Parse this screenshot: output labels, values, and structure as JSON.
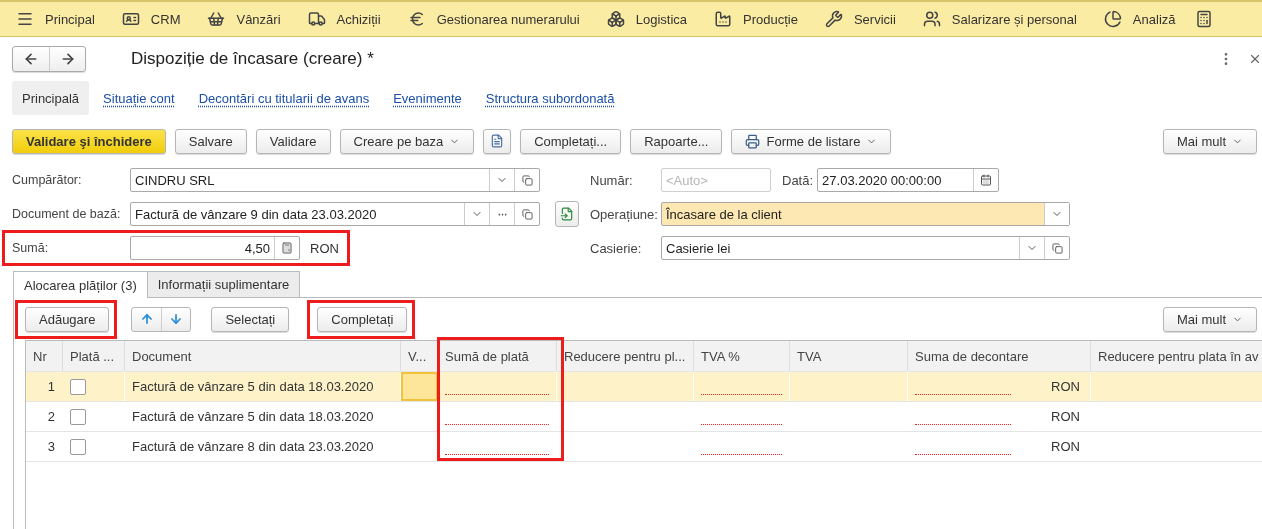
{
  "menu_bar": {
    "items": [
      {
        "label": "Principal"
      },
      {
        "label": "CRM"
      },
      {
        "label": "Vânzări"
      },
      {
        "label": "Achiziții"
      },
      {
        "label": "Gestionarea numerarului"
      },
      {
        "label": "Logistica"
      },
      {
        "label": "Producție"
      },
      {
        "label": "Servicii"
      },
      {
        "label": "Salarizare și personal"
      },
      {
        "label": "Analiză"
      }
    ]
  },
  "window": {
    "title": "Dispoziție de încasare (creare) *"
  },
  "section_tabs": [
    {
      "label": "Principală",
      "selected": true
    },
    {
      "label": "Situație cont",
      "selected": false
    },
    {
      "label": "Decontări cu titularii de avans",
      "selected": false
    },
    {
      "label": "Evenimente",
      "selected": false
    },
    {
      "label": "Structura subordonată",
      "selected": false
    }
  ],
  "toolbar": [
    {
      "kind": "primary",
      "label": "Validare şi închidere"
    },
    {
      "kind": "plain",
      "label": "Salvare"
    },
    {
      "kind": "plain",
      "label": "Validare"
    },
    {
      "kind": "menu",
      "label": "Creare pe baza"
    },
    {
      "kind": "icon"
    },
    {
      "kind": "plain",
      "label": "Completați..."
    },
    {
      "kind": "plain",
      "label": "Rapoarte..."
    },
    {
      "kind": "print",
      "label": "Forme de listare"
    }
  ],
  "toolbar_more": "Mai mult",
  "left_fields": [
    {
      "kind": "reference",
      "label": "Cumpărător:",
      "value": "CINDRU SRL"
    },
    {
      "kind": "document",
      "label": "Document de bază:",
      "value": "Factură de vânzare 9 din data 23.03.2020"
    },
    {
      "kind": "amount",
      "label": "Sumă:",
      "value": "4,50",
      "unit": "RON",
      "highlighted": true
    }
  ],
  "right_fields": [
    {
      "kind": "number",
      "label": "Număr:",
      "placeholder": "<Auto>",
      "date_label": "Dată:",
      "date_value": "27.03.2020 00:00:00",
      "active": false
    },
    {
      "kind": "choice",
      "label": "Operațiune:",
      "value": "Încasare de la client",
      "active": true
    },
    {
      "kind": "reference",
      "label": "Casierie:",
      "value": "Casierie lei",
      "active": false
    }
  ],
  "inner_tabs": [
    {
      "label": "Alocarea plăților (3)",
      "selected": true
    },
    {
      "label": "Informații suplimentare",
      "selected": false
    }
  ],
  "table_toolbar": [
    {
      "kind": "plain",
      "label": "Adăugare",
      "highlighted": true
    },
    {
      "kind": "arrows"
    },
    {
      "kind": "plain",
      "label": "Selectați"
    },
    {
      "kind": "plain",
      "label": "Completați",
      "highlighted": true
    }
  ],
  "table_more": "Mai mult",
  "table": {
    "columns": [
      {
        "label": "Nr"
      },
      {
        "label": "Plată ..."
      },
      {
        "label": "Document"
      },
      {
        "label": "V..."
      },
      {
        "label": "Sumă de plată",
        "highlighted": true
      },
      {
        "label": "Reducere pentru pl..."
      },
      {
        "label": "TVA %"
      },
      {
        "label": "TVA"
      },
      {
        "label": "Suma de decontare"
      },
      {
        "label": "Reducere pentru plata în av"
      }
    ],
    "rows": [
      {
        "nr": "1",
        "checked": false,
        "document": "Factură de vânzare 5 din data 18.03.2020",
        "currency": "RON",
        "selected": true
      },
      {
        "nr": "2",
        "checked": false,
        "document": "Factură de vânzare 5 din data 18.03.2020",
        "currency": "RON",
        "selected": false
      },
      {
        "nr": "3",
        "checked": false,
        "document": "Factură de vânzare 8 din data 23.03.2020",
        "currency": "RON",
        "selected": false
      }
    ]
  }
}
